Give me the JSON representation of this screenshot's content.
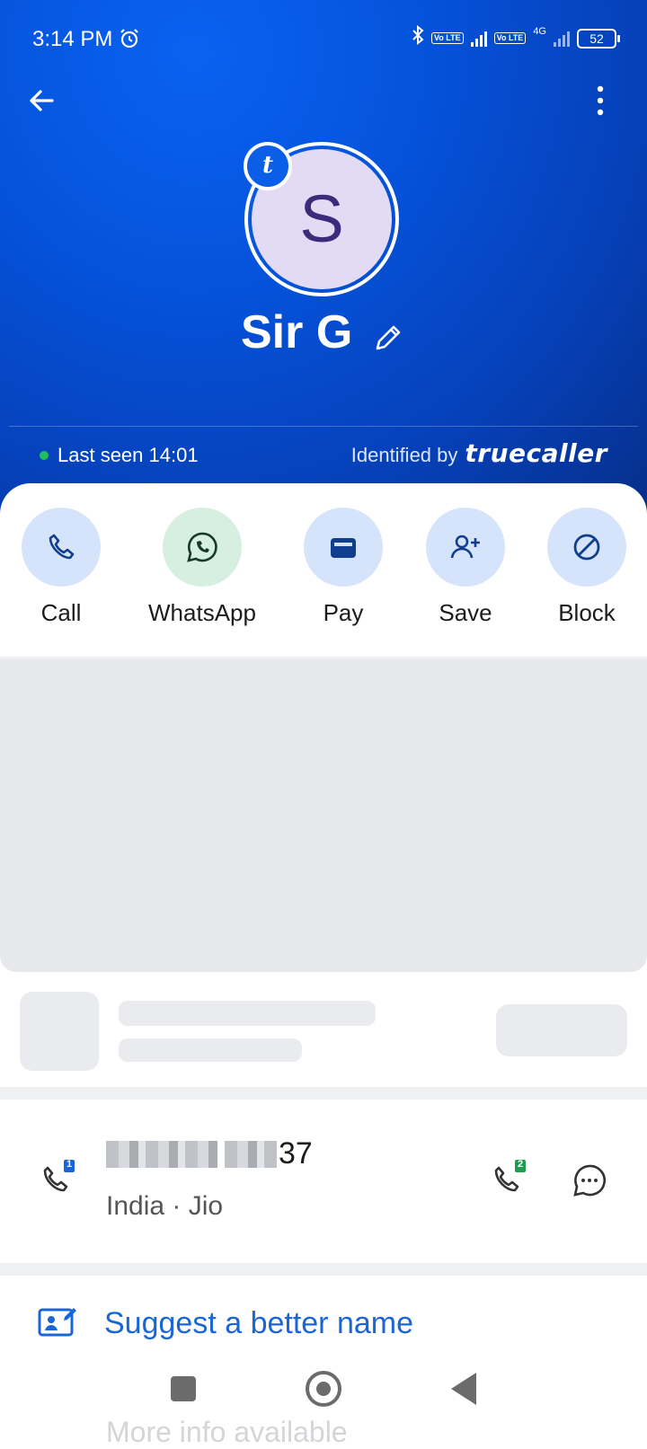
{
  "status_bar": {
    "time": "3:14 PM",
    "volte_label": "Vo LTE",
    "network": "4G",
    "battery": "52"
  },
  "profile": {
    "avatar_letter": "S",
    "badge_letter": "t",
    "name": "Sir G",
    "last_seen": "Last seen 14:01",
    "identified_prefix": "Identified by",
    "identified_brand": "truecaller"
  },
  "actions": [
    {
      "label": "Call",
      "icon": "phone-icon"
    },
    {
      "label": "WhatsApp",
      "icon": "whatsapp-icon"
    },
    {
      "label": "Pay",
      "icon": "wallet-icon"
    },
    {
      "label": "Save",
      "icon": "add-person-icon"
    },
    {
      "label": "Block",
      "icon": "block-icon"
    }
  ],
  "number": {
    "tail": "37",
    "details": "India · Jio",
    "sim1": "1",
    "sim2": "2"
  },
  "suggest_label": "Suggest a better name",
  "more_info": "More info available",
  "colors": {
    "header_blue": "#0553dc",
    "action_bg": "#d6e4fb",
    "whatsapp_bg": "#d6efe0",
    "link_blue": "#1a66d6",
    "online_green": "#1fbf5a"
  }
}
